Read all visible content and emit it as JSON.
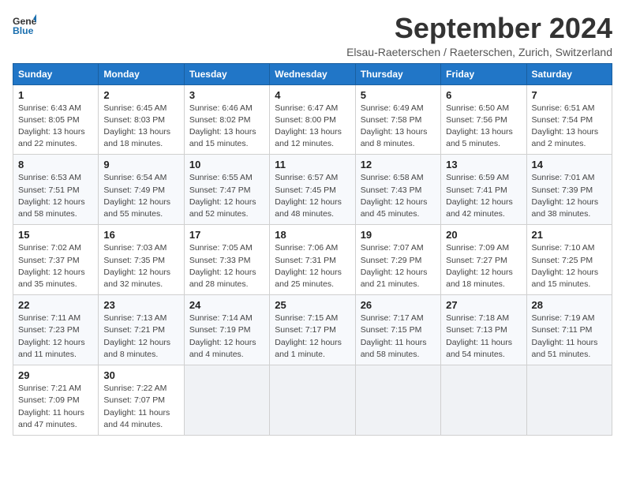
{
  "header": {
    "logo_line1": "General",
    "logo_line2": "Blue",
    "title": "September 2024",
    "subtitle": "Elsau-Raeterschen / Raeterschen, Zurich, Switzerland"
  },
  "columns": [
    "Sunday",
    "Monday",
    "Tuesday",
    "Wednesday",
    "Thursday",
    "Friday",
    "Saturday"
  ],
  "weeks": [
    [
      {
        "day": "1",
        "info": "Sunrise: 6:43 AM\nSunset: 8:05 PM\nDaylight: 13 hours\nand 22 minutes."
      },
      {
        "day": "2",
        "info": "Sunrise: 6:45 AM\nSunset: 8:03 PM\nDaylight: 13 hours\nand 18 minutes."
      },
      {
        "day": "3",
        "info": "Sunrise: 6:46 AM\nSunset: 8:02 PM\nDaylight: 13 hours\nand 15 minutes."
      },
      {
        "day": "4",
        "info": "Sunrise: 6:47 AM\nSunset: 8:00 PM\nDaylight: 13 hours\nand 12 minutes."
      },
      {
        "day": "5",
        "info": "Sunrise: 6:49 AM\nSunset: 7:58 PM\nDaylight: 13 hours\nand 8 minutes."
      },
      {
        "day": "6",
        "info": "Sunrise: 6:50 AM\nSunset: 7:56 PM\nDaylight: 13 hours\nand 5 minutes."
      },
      {
        "day": "7",
        "info": "Sunrise: 6:51 AM\nSunset: 7:54 PM\nDaylight: 13 hours\nand 2 minutes."
      }
    ],
    [
      {
        "day": "8",
        "info": "Sunrise: 6:53 AM\nSunset: 7:51 PM\nDaylight: 12 hours\nand 58 minutes."
      },
      {
        "day": "9",
        "info": "Sunrise: 6:54 AM\nSunset: 7:49 PM\nDaylight: 12 hours\nand 55 minutes."
      },
      {
        "day": "10",
        "info": "Sunrise: 6:55 AM\nSunset: 7:47 PM\nDaylight: 12 hours\nand 52 minutes."
      },
      {
        "day": "11",
        "info": "Sunrise: 6:57 AM\nSunset: 7:45 PM\nDaylight: 12 hours\nand 48 minutes."
      },
      {
        "day": "12",
        "info": "Sunrise: 6:58 AM\nSunset: 7:43 PM\nDaylight: 12 hours\nand 45 minutes."
      },
      {
        "day": "13",
        "info": "Sunrise: 6:59 AM\nSunset: 7:41 PM\nDaylight: 12 hours\nand 42 minutes."
      },
      {
        "day": "14",
        "info": "Sunrise: 7:01 AM\nSunset: 7:39 PM\nDaylight: 12 hours\nand 38 minutes."
      }
    ],
    [
      {
        "day": "15",
        "info": "Sunrise: 7:02 AM\nSunset: 7:37 PM\nDaylight: 12 hours\nand 35 minutes."
      },
      {
        "day": "16",
        "info": "Sunrise: 7:03 AM\nSunset: 7:35 PM\nDaylight: 12 hours\nand 32 minutes."
      },
      {
        "day": "17",
        "info": "Sunrise: 7:05 AM\nSunset: 7:33 PM\nDaylight: 12 hours\nand 28 minutes."
      },
      {
        "day": "18",
        "info": "Sunrise: 7:06 AM\nSunset: 7:31 PM\nDaylight: 12 hours\nand 25 minutes."
      },
      {
        "day": "19",
        "info": "Sunrise: 7:07 AM\nSunset: 7:29 PM\nDaylight: 12 hours\nand 21 minutes."
      },
      {
        "day": "20",
        "info": "Sunrise: 7:09 AM\nSunset: 7:27 PM\nDaylight: 12 hours\nand 18 minutes."
      },
      {
        "day": "21",
        "info": "Sunrise: 7:10 AM\nSunset: 7:25 PM\nDaylight: 12 hours\nand 15 minutes."
      }
    ],
    [
      {
        "day": "22",
        "info": "Sunrise: 7:11 AM\nSunset: 7:23 PM\nDaylight: 12 hours\nand 11 minutes."
      },
      {
        "day": "23",
        "info": "Sunrise: 7:13 AM\nSunset: 7:21 PM\nDaylight: 12 hours\nand 8 minutes."
      },
      {
        "day": "24",
        "info": "Sunrise: 7:14 AM\nSunset: 7:19 PM\nDaylight: 12 hours\nand 4 minutes."
      },
      {
        "day": "25",
        "info": "Sunrise: 7:15 AM\nSunset: 7:17 PM\nDaylight: 12 hours\nand 1 minute."
      },
      {
        "day": "26",
        "info": "Sunrise: 7:17 AM\nSunset: 7:15 PM\nDaylight: 11 hours\nand 58 minutes."
      },
      {
        "day": "27",
        "info": "Sunrise: 7:18 AM\nSunset: 7:13 PM\nDaylight: 11 hours\nand 54 minutes."
      },
      {
        "day": "28",
        "info": "Sunrise: 7:19 AM\nSunset: 7:11 PM\nDaylight: 11 hours\nand 51 minutes."
      }
    ],
    [
      {
        "day": "29",
        "info": "Sunrise: 7:21 AM\nSunset: 7:09 PM\nDaylight: 11 hours\nand 47 minutes."
      },
      {
        "day": "30",
        "info": "Sunrise: 7:22 AM\nSunset: 7:07 PM\nDaylight: 11 hours\nand 44 minutes."
      },
      {
        "day": "",
        "info": ""
      },
      {
        "day": "",
        "info": ""
      },
      {
        "day": "",
        "info": ""
      },
      {
        "day": "",
        "info": ""
      },
      {
        "day": "",
        "info": ""
      }
    ]
  ]
}
